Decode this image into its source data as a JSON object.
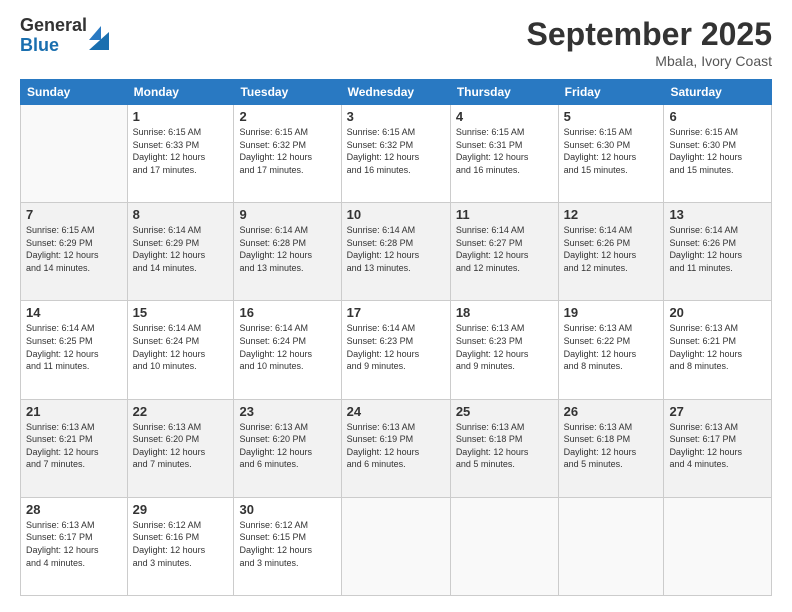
{
  "logo": {
    "general": "General",
    "blue": "Blue"
  },
  "title": "September 2025",
  "location": "Mbala, Ivory Coast",
  "days_header": [
    "Sunday",
    "Monday",
    "Tuesday",
    "Wednesday",
    "Thursday",
    "Friday",
    "Saturday"
  ],
  "weeks": [
    [
      {
        "day": "",
        "info": ""
      },
      {
        "day": "1",
        "info": "Sunrise: 6:15 AM\nSunset: 6:33 PM\nDaylight: 12 hours\nand 17 minutes."
      },
      {
        "day": "2",
        "info": "Sunrise: 6:15 AM\nSunset: 6:32 PM\nDaylight: 12 hours\nand 17 minutes."
      },
      {
        "day": "3",
        "info": "Sunrise: 6:15 AM\nSunset: 6:32 PM\nDaylight: 12 hours\nand 16 minutes."
      },
      {
        "day": "4",
        "info": "Sunrise: 6:15 AM\nSunset: 6:31 PM\nDaylight: 12 hours\nand 16 minutes."
      },
      {
        "day": "5",
        "info": "Sunrise: 6:15 AM\nSunset: 6:30 PM\nDaylight: 12 hours\nand 15 minutes."
      },
      {
        "day": "6",
        "info": "Sunrise: 6:15 AM\nSunset: 6:30 PM\nDaylight: 12 hours\nand 15 minutes."
      }
    ],
    [
      {
        "day": "7",
        "info": "Sunrise: 6:15 AM\nSunset: 6:29 PM\nDaylight: 12 hours\nand 14 minutes."
      },
      {
        "day": "8",
        "info": "Sunrise: 6:14 AM\nSunset: 6:29 PM\nDaylight: 12 hours\nand 14 minutes."
      },
      {
        "day": "9",
        "info": "Sunrise: 6:14 AM\nSunset: 6:28 PM\nDaylight: 12 hours\nand 13 minutes."
      },
      {
        "day": "10",
        "info": "Sunrise: 6:14 AM\nSunset: 6:28 PM\nDaylight: 12 hours\nand 13 minutes."
      },
      {
        "day": "11",
        "info": "Sunrise: 6:14 AM\nSunset: 6:27 PM\nDaylight: 12 hours\nand 12 minutes."
      },
      {
        "day": "12",
        "info": "Sunrise: 6:14 AM\nSunset: 6:26 PM\nDaylight: 12 hours\nand 12 minutes."
      },
      {
        "day": "13",
        "info": "Sunrise: 6:14 AM\nSunset: 6:26 PM\nDaylight: 12 hours\nand 11 minutes."
      }
    ],
    [
      {
        "day": "14",
        "info": "Sunrise: 6:14 AM\nSunset: 6:25 PM\nDaylight: 12 hours\nand 11 minutes."
      },
      {
        "day": "15",
        "info": "Sunrise: 6:14 AM\nSunset: 6:24 PM\nDaylight: 12 hours\nand 10 minutes."
      },
      {
        "day": "16",
        "info": "Sunrise: 6:14 AM\nSunset: 6:24 PM\nDaylight: 12 hours\nand 10 minutes."
      },
      {
        "day": "17",
        "info": "Sunrise: 6:14 AM\nSunset: 6:23 PM\nDaylight: 12 hours\nand 9 minutes."
      },
      {
        "day": "18",
        "info": "Sunrise: 6:13 AM\nSunset: 6:23 PM\nDaylight: 12 hours\nand 9 minutes."
      },
      {
        "day": "19",
        "info": "Sunrise: 6:13 AM\nSunset: 6:22 PM\nDaylight: 12 hours\nand 8 minutes."
      },
      {
        "day": "20",
        "info": "Sunrise: 6:13 AM\nSunset: 6:21 PM\nDaylight: 12 hours\nand 8 minutes."
      }
    ],
    [
      {
        "day": "21",
        "info": "Sunrise: 6:13 AM\nSunset: 6:21 PM\nDaylight: 12 hours\nand 7 minutes."
      },
      {
        "day": "22",
        "info": "Sunrise: 6:13 AM\nSunset: 6:20 PM\nDaylight: 12 hours\nand 7 minutes."
      },
      {
        "day": "23",
        "info": "Sunrise: 6:13 AM\nSunset: 6:20 PM\nDaylight: 12 hours\nand 6 minutes."
      },
      {
        "day": "24",
        "info": "Sunrise: 6:13 AM\nSunset: 6:19 PM\nDaylight: 12 hours\nand 6 minutes."
      },
      {
        "day": "25",
        "info": "Sunrise: 6:13 AM\nSunset: 6:18 PM\nDaylight: 12 hours\nand 5 minutes."
      },
      {
        "day": "26",
        "info": "Sunrise: 6:13 AM\nSunset: 6:18 PM\nDaylight: 12 hours\nand 5 minutes."
      },
      {
        "day": "27",
        "info": "Sunrise: 6:13 AM\nSunset: 6:17 PM\nDaylight: 12 hours\nand 4 minutes."
      }
    ],
    [
      {
        "day": "28",
        "info": "Sunrise: 6:13 AM\nSunset: 6:17 PM\nDaylight: 12 hours\nand 4 minutes."
      },
      {
        "day": "29",
        "info": "Sunrise: 6:12 AM\nSunset: 6:16 PM\nDaylight: 12 hours\nand 3 minutes."
      },
      {
        "day": "30",
        "info": "Sunrise: 6:12 AM\nSunset: 6:15 PM\nDaylight: 12 hours\nand 3 minutes."
      },
      {
        "day": "",
        "info": ""
      },
      {
        "day": "",
        "info": ""
      },
      {
        "day": "",
        "info": ""
      },
      {
        "day": "",
        "info": ""
      }
    ]
  ]
}
